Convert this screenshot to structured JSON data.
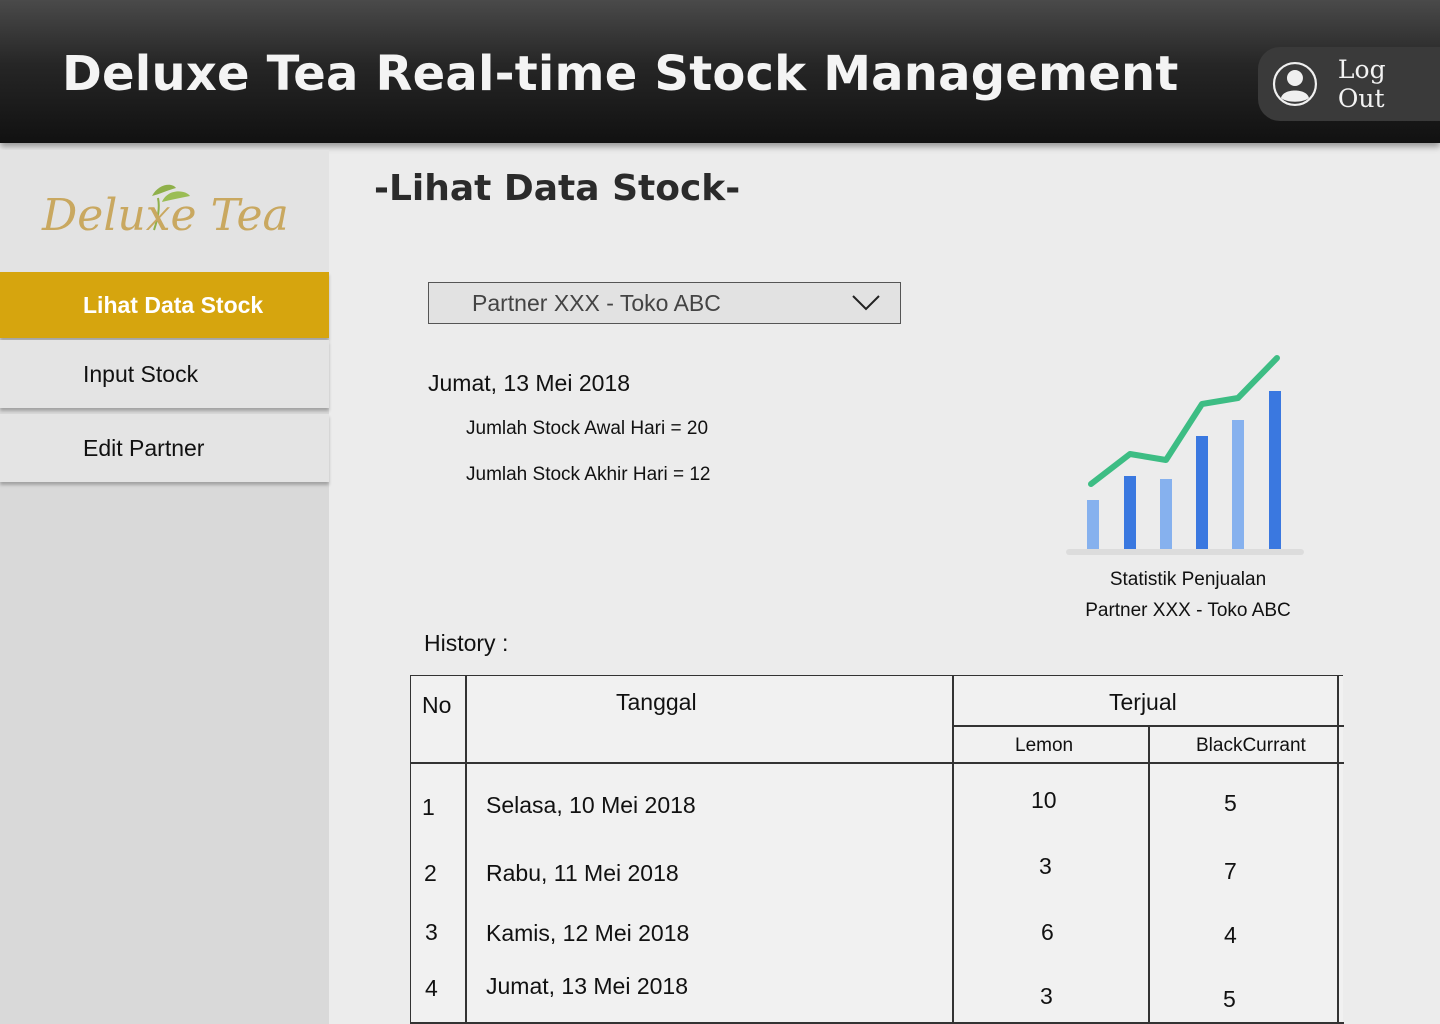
{
  "header": {
    "title": "Deluxe Tea Real-time Stock Management",
    "logout_label": "Log Out",
    "logout_icon": "user-circle-icon"
  },
  "sidebar": {
    "logo_text": "Deluxe Tea",
    "items": [
      {
        "label": "Lihat Data Stock",
        "active": true
      },
      {
        "label": "Input Stock",
        "active": false
      },
      {
        "label": "Edit Partner",
        "active": false
      }
    ]
  },
  "main": {
    "page_title": "-Lihat Data Stock-",
    "partner_select": {
      "value": "Partner XXX - Toko ABC",
      "icon": "chevron-down-icon"
    },
    "date": "Jumat, 13 Mei 2018",
    "stock_awal": "Jumlah Stock Awal Hari = 20",
    "stock_akhir": "Jumlah Stock Akhir Hari = 12",
    "chart_caption_line1": "Statistik Penjualan",
    "chart_caption_line2": "Partner XXX - Toko ABC",
    "history_label": "History :",
    "table": {
      "headers": {
        "no": "No",
        "tanggal": "Tanggal",
        "terjual": "Terjual",
        "lemon": "Lemon",
        "blackcurrant": "BlackCurrant"
      },
      "rows": [
        {
          "no": "1",
          "tanggal": "Selasa, 10 Mei 2018",
          "lemon": "10",
          "blackcurrant": "5"
        },
        {
          "no": "2",
          "tanggal": "Rabu, 11 Mei 2018",
          "lemon": "3",
          "blackcurrant": "7"
        },
        {
          "no": "3",
          "tanggal": "Kamis, 12 Mei 2018",
          "lemon": "6",
          "blackcurrant": "4"
        },
        {
          "no": "4",
          "tanggal": "Jumat, 13 Mei 2018",
          "lemon": "3",
          "blackcurrant": "5"
        }
      ]
    }
  },
  "colors": {
    "accent": "#d6a50e",
    "chart_line": "#3dbd84",
    "bar_dark": "#3a78e0",
    "bar_light": "#86b1ee"
  }
}
